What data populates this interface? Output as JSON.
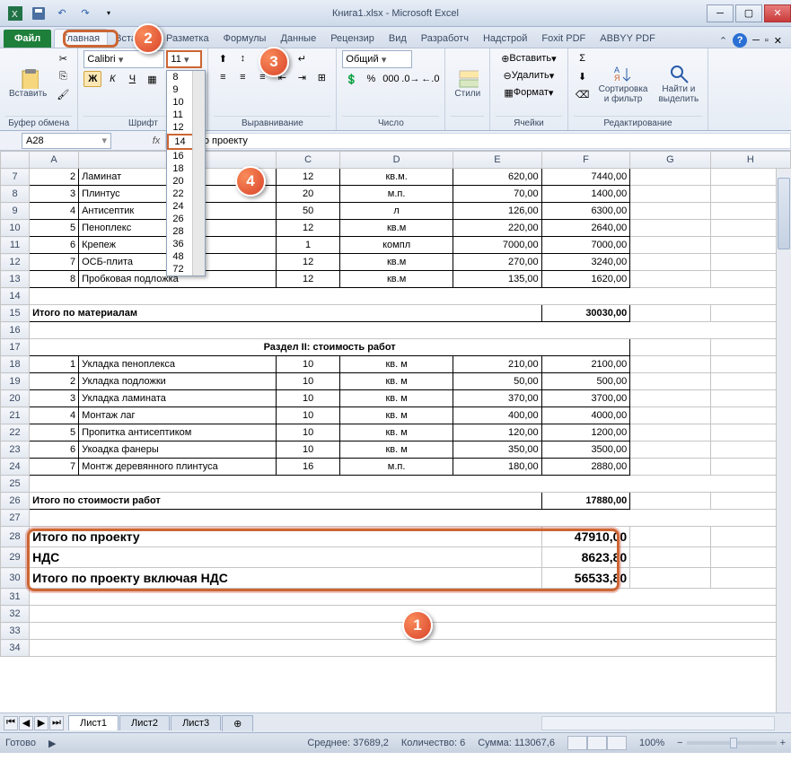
{
  "title": "Книга1.xlsx - Microsoft Excel",
  "qat": {
    "save": "💾",
    "undo": "↶",
    "redo": "↷"
  },
  "tabs": {
    "file": "Файл",
    "items": [
      "Главная",
      "Вставка",
      "Разметка",
      "Формулы",
      "Данные",
      "Рецензир",
      "Вид",
      "Разработч",
      "Надстрой",
      "Foxit PDF",
      "ABBYY PDF"
    ],
    "active": 0
  },
  "ribbon": {
    "clipboard": {
      "paste": "Вставить",
      "label": "Буфер обмена"
    },
    "font": {
      "name": "Calibri",
      "size": "11",
      "label": "Шрифт",
      "sizes": [
        "8",
        "9",
        "10",
        "11",
        "12",
        "14",
        "16",
        "18",
        "20",
        "22",
        "24",
        "26",
        "28",
        "36",
        "48",
        "72"
      ],
      "selected_size": "14"
    },
    "align": {
      "label": "Выравнивание"
    },
    "number": {
      "format": "Общий",
      "label": "Число"
    },
    "styles": {
      "btn": "Стили",
      "label": ""
    },
    "cells": {
      "insert": "Вставить",
      "delete": "Удалить",
      "format": "Формат",
      "label": "Ячейки"
    },
    "editing": {
      "sort": "Сортировка\nи фильтр",
      "find": "Найти и\nвыделить",
      "label": "Редактирование"
    }
  },
  "namebox": "A28",
  "formula": "Итого по проекту",
  "columns": [
    "",
    "A",
    "B",
    "C",
    "D",
    "E",
    "F",
    "G",
    "H"
  ],
  "rows": [
    {
      "n": 7,
      "a": "2",
      "b": "Ламинат",
      "c": "12",
      "d": "кв.м.",
      "e": "620,00",
      "f": "7440,00"
    },
    {
      "n": 8,
      "a": "3",
      "b": "Плинтус",
      "c": "20",
      "d": "м.п.",
      "e": "70,00",
      "f": "1400,00"
    },
    {
      "n": 9,
      "a": "4",
      "b": "Антисептик",
      "c": "50",
      "d": "л",
      "e": "126,00",
      "f": "6300,00"
    },
    {
      "n": 10,
      "a": "5",
      "b": "Пеноплекс",
      "c": "12",
      "d": "кв.м",
      "e": "220,00",
      "f": "2640,00"
    },
    {
      "n": 11,
      "a": "6",
      "b": "Крепеж",
      "c": "1",
      "d": "компл",
      "e": "7000,00",
      "f": "7000,00"
    },
    {
      "n": 12,
      "a": "7",
      "b": "ОСБ-плита",
      "c": "12",
      "d": "кв.м",
      "e": "270,00",
      "f": "3240,00"
    },
    {
      "n": 13,
      "a": "8",
      "b": "Пробковая подложка",
      "c": "12",
      "d": "кв.м",
      "e": "135,00",
      "f": "1620,00"
    }
  ],
  "subtotal1": {
    "label": "Итого по материалам",
    "value": "30030,00"
  },
  "section2": "Раздел II: стоимость работ",
  "rows2": [
    {
      "n": 18,
      "a": "1",
      "b": "Укладка пеноплекса",
      "c": "10",
      "d": "кв. м",
      "e": "210,00",
      "f": "2100,00"
    },
    {
      "n": 19,
      "a": "2",
      "b": "Укладка подложки",
      "c": "10",
      "d": "кв. м",
      "e": "50,00",
      "f": "500,00"
    },
    {
      "n": 20,
      "a": "3",
      "b": "Укладка  ламината",
      "c": "10",
      "d": "кв. м",
      "e": "370,00",
      "f": "3700,00"
    },
    {
      "n": 21,
      "a": "4",
      "b": "Монтаж лаг",
      "c": "10",
      "d": "кв. м",
      "e": "400,00",
      "f": "4000,00"
    },
    {
      "n": 22,
      "a": "5",
      "b": "Пропитка антисептиком",
      "c": "10",
      "d": "кв. м",
      "e": "120,00",
      "f": "1200,00"
    },
    {
      "n": 23,
      "a": "6",
      "b": "Укоадка фанеры",
      "c": "10",
      "d": "кв. м",
      "e": "350,00",
      "f": "3500,00"
    },
    {
      "n": 24,
      "a": "7",
      "b": "Монтж деревянного плинтуса",
      "c": "16",
      "d": "м.п.",
      "e": "180,00",
      "f": "2880,00"
    }
  ],
  "subtotal2": {
    "label": "Итого по стоимости работ",
    "value": "17880,00"
  },
  "totals": [
    {
      "n": 28,
      "label": "Итого по проекту",
      "value": "47910,00"
    },
    {
      "n": 29,
      "label": "НДС",
      "value": "8623,80"
    },
    {
      "n": 30,
      "label": "Итого по проекту включая НДС",
      "value": "56533,80"
    }
  ],
  "empty_rows": [
    14,
    16,
    25,
    27,
    31,
    32,
    33,
    34
  ],
  "sheets": [
    "Лист1",
    "Лист2",
    "Лист3"
  ],
  "status": {
    "ready": "Готово",
    "avg_label": "Среднее:",
    "avg": "37689,2",
    "count_label": "Количество:",
    "count": "6",
    "sum_label": "Сумма:",
    "sum": "113067,6",
    "zoom": "100%"
  },
  "callouts": [
    "1",
    "2",
    "3",
    "4"
  ]
}
